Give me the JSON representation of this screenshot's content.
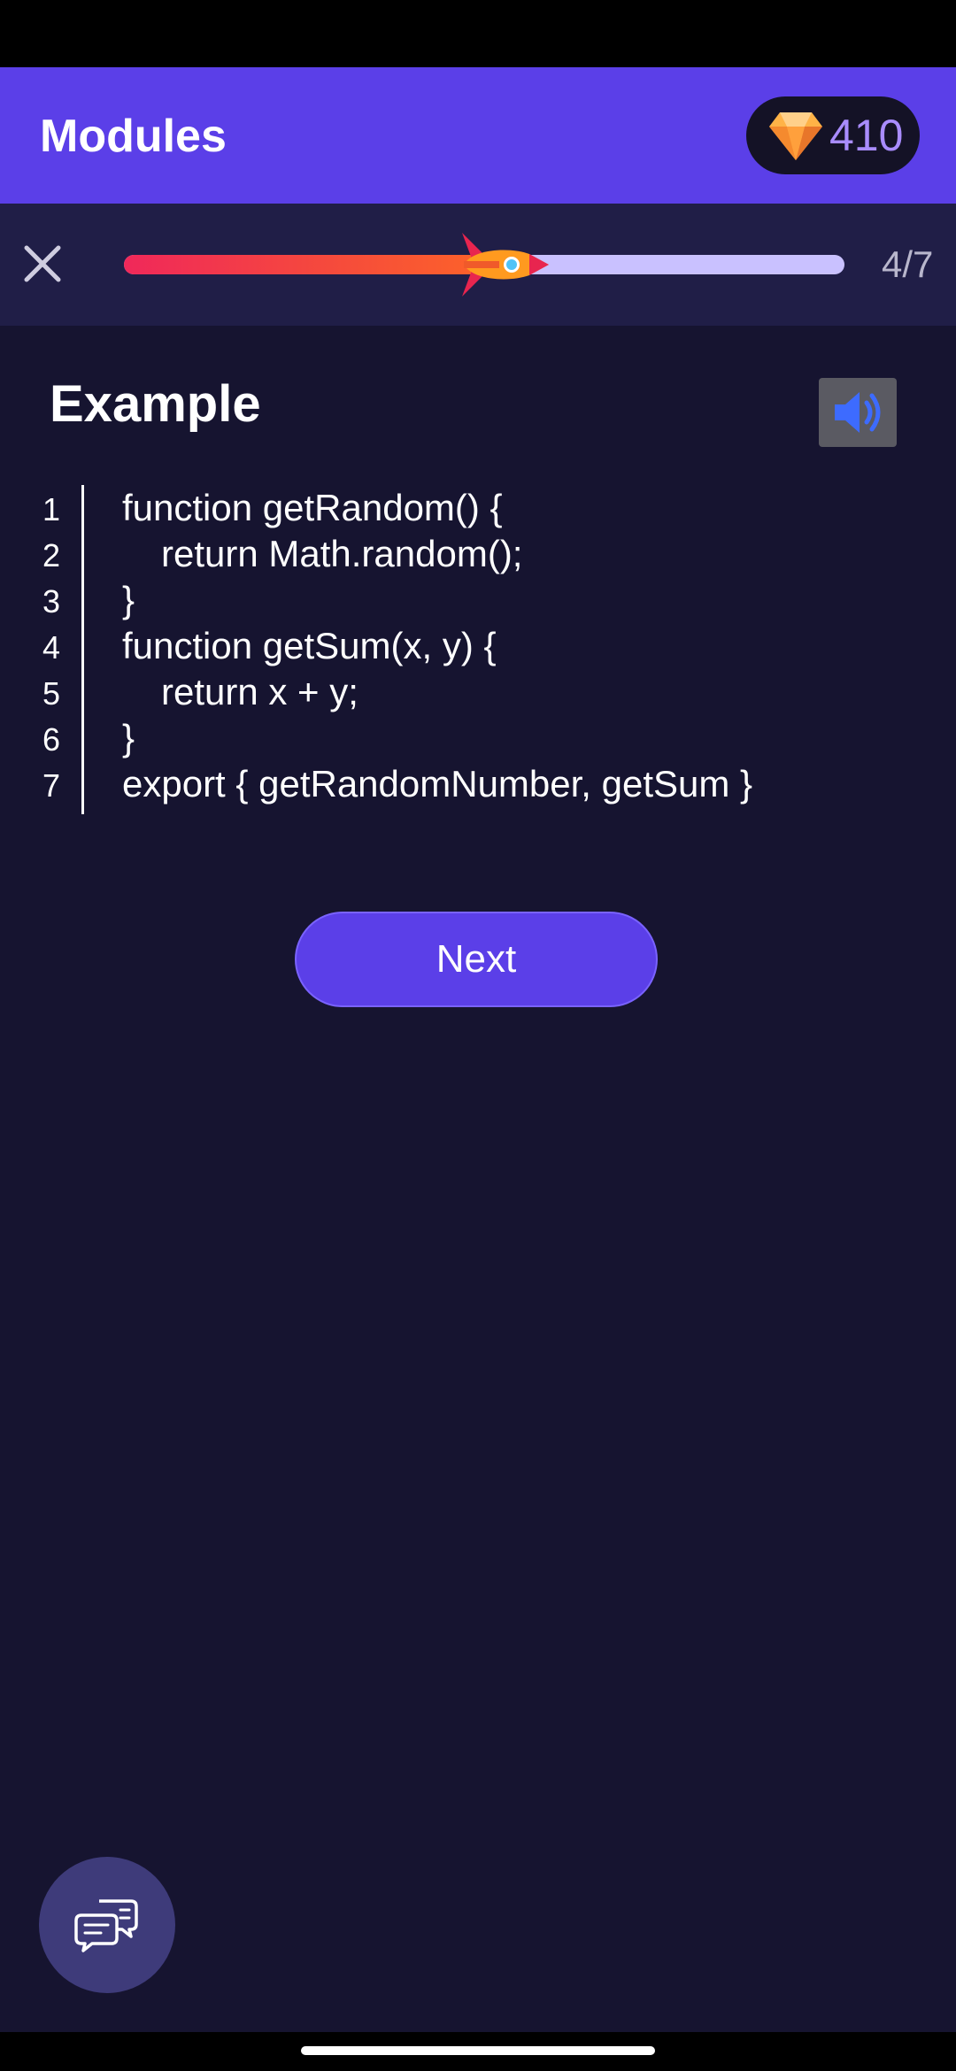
{
  "header": {
    "title": "Modules",
    "gems": "410"
  },
  "progress": {
    "label": "4/7",
    "fraction": 0.57
  },
  "lesson": {
    "section_title": "Example"
  },
  "code": {
    "lines": [
      {
        "number": "1",
        "text": "function getRandom() {",
        "indent": false
      },
      {
        "number": "2",
        "text": "return Math.random();",
        "indent": true
      },
      {
        "number": "3",
        "text": "}",
        "indent": false
      },
      {
        "number": "4",
        "text": "function getSum(x, y) {",
        "indent": false
      },
      {
        "number": "5",
        "text": "return x + y;",
        "indent": true
      },
      {
        "number": "6",
        "text": "}",
        "indent": false
      },
      {
        "number": "7",
        "text": "export { getRandomNumber, getSum }",
        "indent": false
      }
    ]
  },
  "actions": {
    "next_label": "Next"
  },
  "colors": {
    "accent": "#5b3fe8",
    "background": "#161430",
    "progress_track": "#c9c1ff",
    "gem_text": "#a98cff"
  },
  "icons": {
    "gem": "gem-icon",
    "close": "close-icon",
    "rocket": "rocket-icon",
    "audio": "speaker-icon",
    "chat": "chat-bubbles-icon"
  }
}
